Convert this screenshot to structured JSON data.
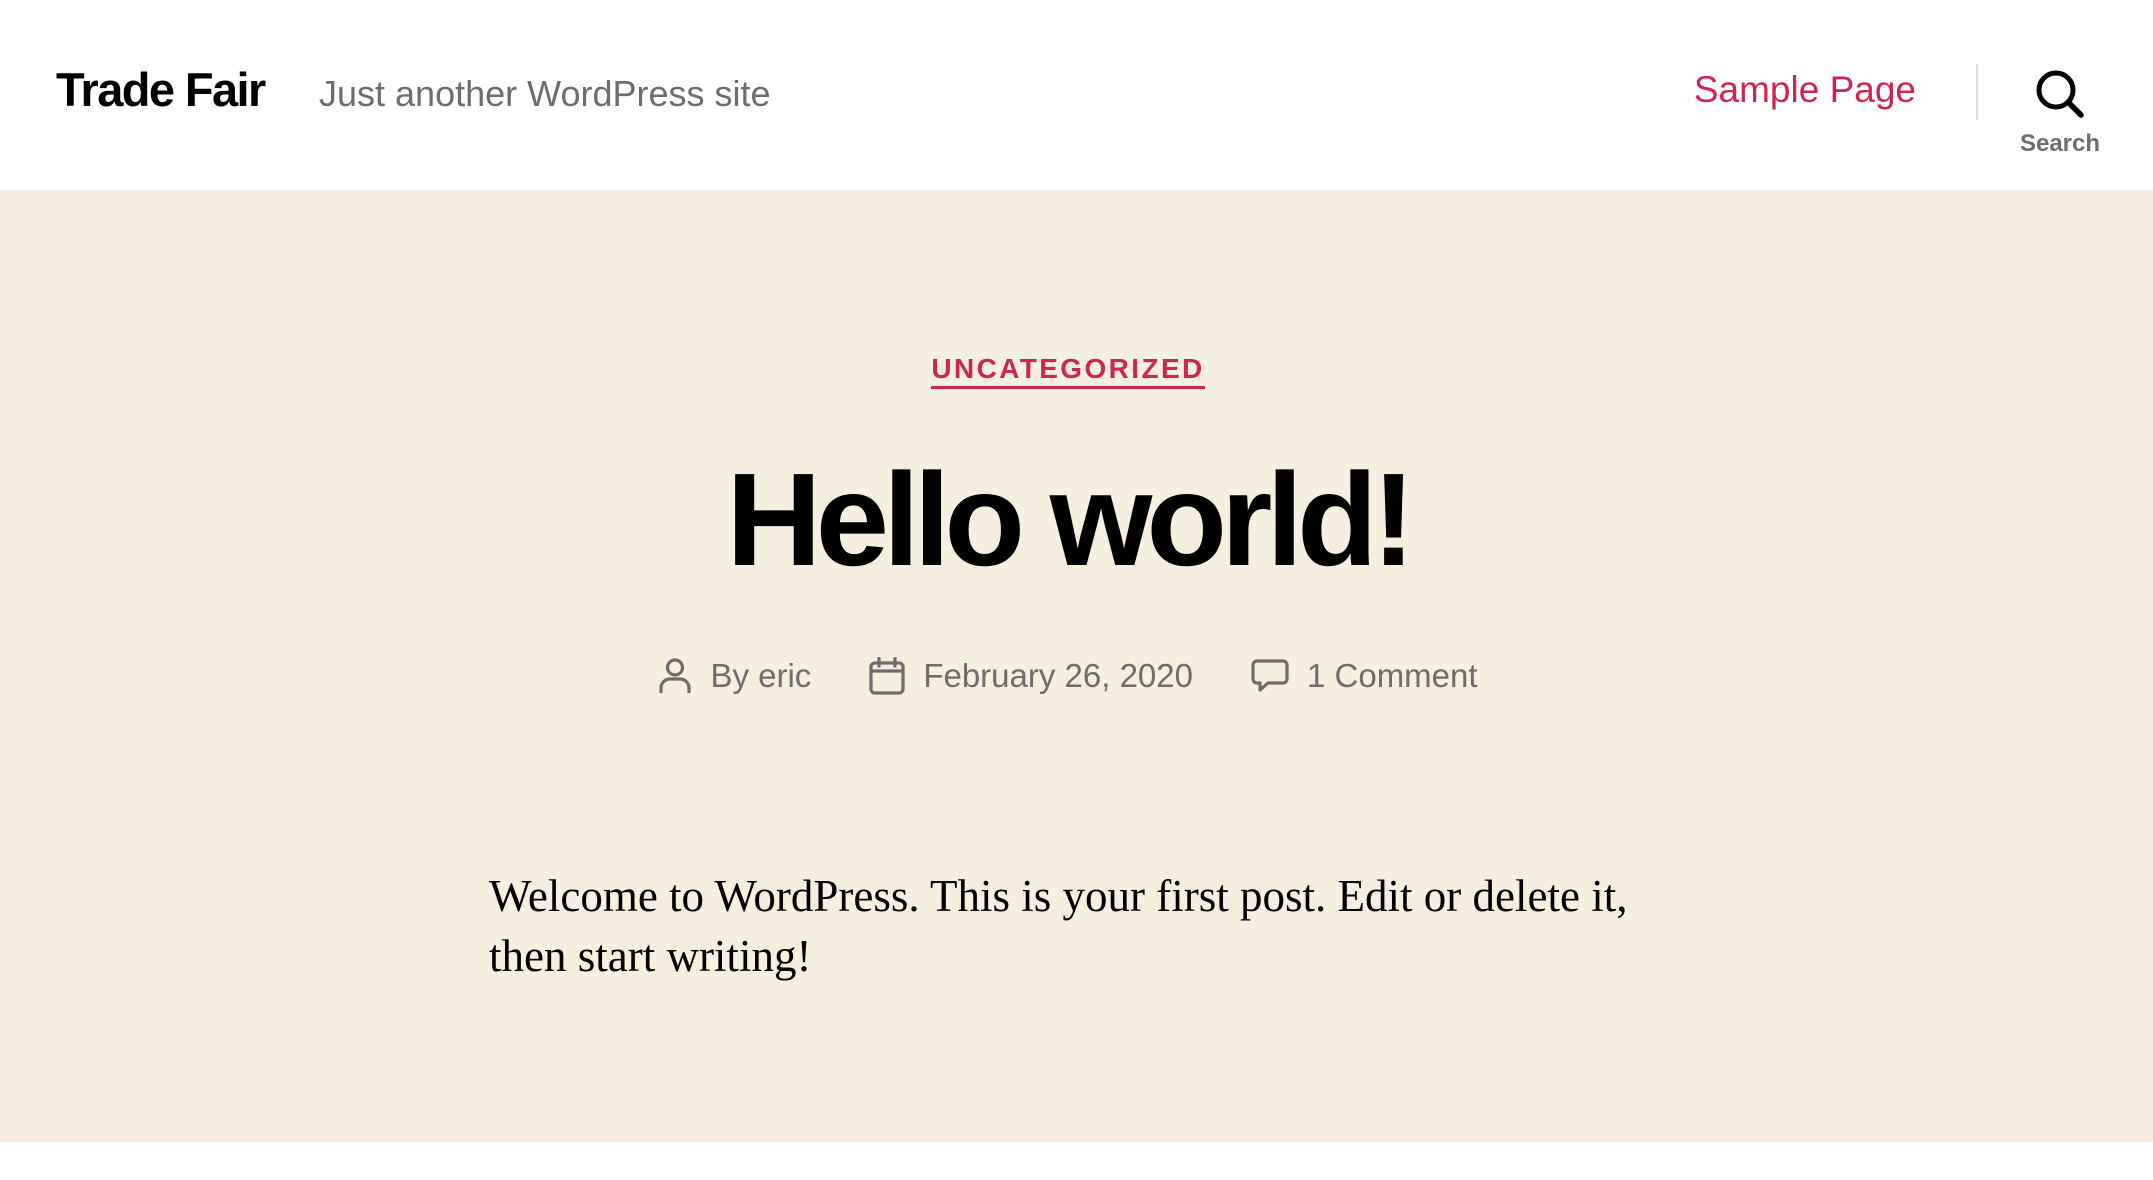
{
  "header": {
    "site_title": "Trade Fair",
    "site_description": "Just another WordPress site",
    "nav": {
      "sample_page": "Sample Page"
    },
    "search": {
      "label": "Search",
      "icon": "search-icon"
    }
  },
  "post": {
    "category": "UNCATEGORIZED",
    "title": "Hello world!",
    "meta": {
      "author": "By eric",
      "author_icon": "user-icon",
      "date": "February 26, 2020",
      "date_icon": "calendar-icon",
      "comments": "1 Comment",
      "comments_icon": "comment-icon"
    },
    "content": "Welcome to WordPress. This is your first post. Edit or delete it, then start writing!"
  },
  "colors": {
    "accent": "#cd2653",
    "background": "#f5efe0",
    "secondary_text": "#6d6d6d"
  }
}
